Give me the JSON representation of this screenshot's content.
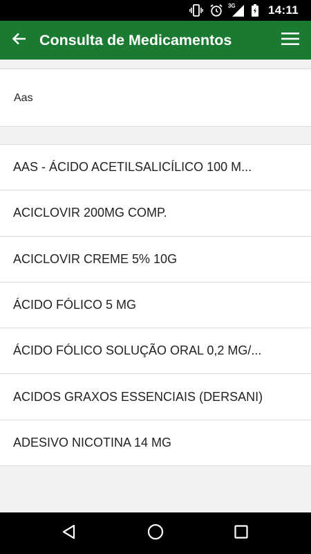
{
  "status_bar": {
    "time": "14:11",
    "network_label": "3G",
    "icons": [
      "vibrate-icon",
      "alarm-icon",
      "signal-icon",
      "battery-icon"
    ]
  },
  "app_bar": {
    "title": "Consulta de Medicamentos",
    "back_icon": "arrow-left-icon",
    "menu_icon": "hamburger-menu-icon",
    "background_color": "#1b7a31"
  },
  "search": {
    "value": "Aas",
    "placeholder": ""
  },
  "results": [
    {
      "label": "AAS - ÁCIDO ACETILSALICÍLICO 100 M..."
    },
    {
      "label": "ACICLOVIR 200MG COMP."
    },
    {
      "label": "ACICLOVIR CREME 5% 10G"
    },
    {
      "label": "ÁCIDO FÓLICO 5 MG"
    },
    {
      "label": "ÁCIDO FÓLICO SOLUÇÃO ORAL 0,2 MG/..."
    },
    {
      "label": "ACIDOS GRAXOS ESSENCIAIS (DERSANI)"
    },
    {
      "label": "ADESIVO NICOTINA 14 MG"
    }
  ],
  "nav_bar": {
    "icons": [
      "back-triangle-icon",
      "home-circle-icon",
      "recents-square-icon"
    ]
  }
}
